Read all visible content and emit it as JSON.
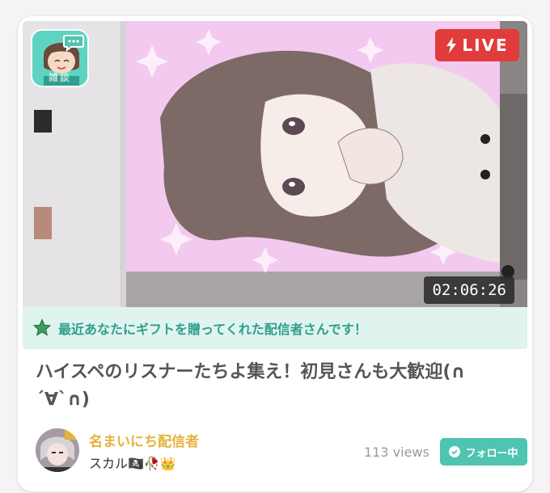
{
  "stream": {
    "category_label": "雑談",
    "live_label": "LIVE",
    "duration": "02:06:26",
    "gift_notice": "最近あなたにギフトを贈ってくれた配信者さんです！",
    "title": "ハイスペのリスナーたちよ集え！初見さんも大歓迎(∩´∀`∩)",
    "views": "113 views"
  },
  "streamer": {
    "name": "名まいにち配信者",
    "subtitle": "スカル🏴‍☠️🥀👑"
  },
  "follow": {
    "label": "フォロー中"
  },
  "colors": {
    "live_red": "#e23b3b",
    "accent_teal": "#4fc4b0",
    "banner_bg": "#dff4ef",
    "name_gold": "#e5b23c"
  },
  "icons": [
    "chat-bubble-icon",
    "lightning-icon",
    "star-icon",
    "checkmark-icon"
  ]
}
